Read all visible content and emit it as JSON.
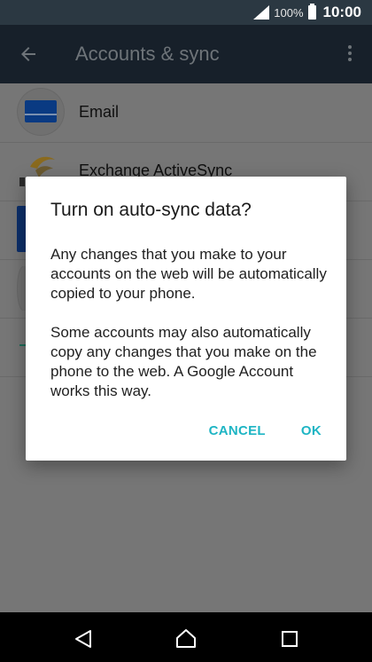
{
  "status_bar": {
    "battery_percent": "100%",
    "time": "10:00",
    "icons": [
      "signal-icon",
      "battery-icon"
    ]
  },
  "app_bar": {
    "title": "Accounts & sync",
    "icons": [
      "back-arrow-icon",
      "overflow-menu-icon"
    ]
  },
  "accounts_list": {
    "items": [
      {
        "label": "Email",
        "icon": "email-icon"
      },
      {
        "label": "Exchange ActiveSync",
        "icon": "exchange-icon"
      }
    ]
  },
  "dialog": {
    "title": "Turn on auto-sync data?",
    "message_1": "Any changes that you make to your accounts on the web will be automatically copied to your phone.",
    "message_2": "Some accounts may also automatically copy any changes that you make on the phone to the web. A Google Account works this way.",
    "cancel_label": "CANCEL",
    "ok_label": "OK",
    "accent_color": "#1eb5c4"
  },
  "nav_bar": {
    "icons": [
      "nav-back-icon",
      "nav-home-icon",
      "nav-recents-icon"
    ]
  }
}
